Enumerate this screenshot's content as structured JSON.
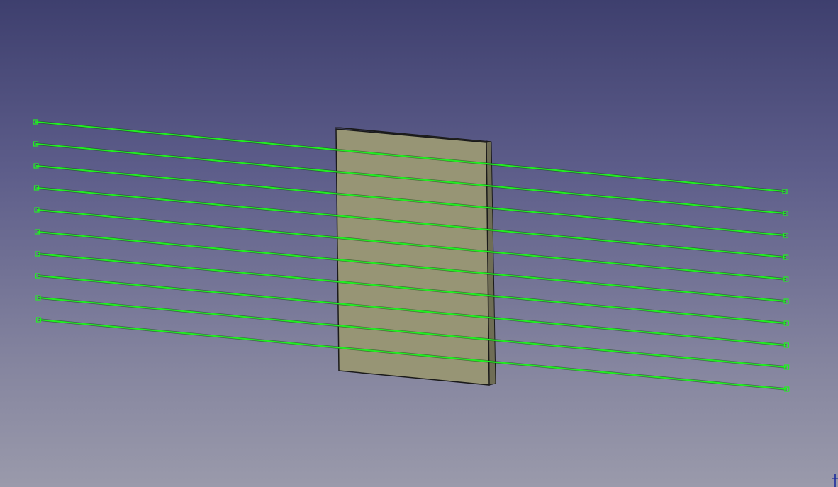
{
  "viewport": {
    "background_top": "#3e3f6e",
    "background_bottom": "#9a9aab"
  },
  "scene": {
    "plate": {
      "face_color": "#979575",
      "side_color": "#6f6d55",
      "top_color": "#2e2e2a",
      "edge_color": "#1a1a1a"
    },
    "wires": {
      "count": 10,
      "color": "#22ee22",
      "endpoint_marker": "small-square"
    }
  },
  "axis_indicator": {
    "icon": "axis-cross-icon",
    "color": "#1b2a9e"
  }
}
